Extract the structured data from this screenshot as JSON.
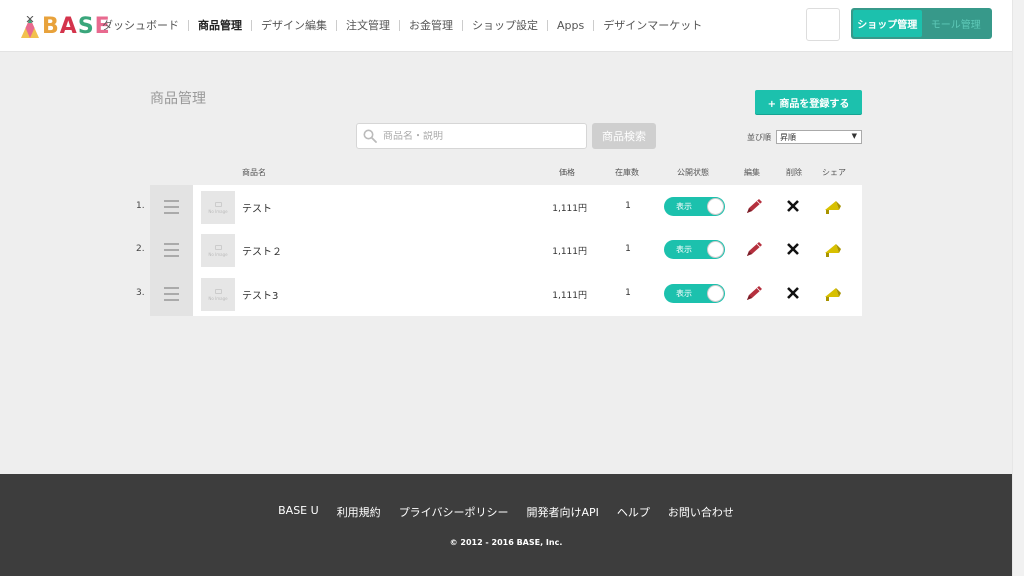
{
  "header": {
    "logo_text": [
      "B",
      "A",
      "S",
      "E"
    ],
    "nav": [
      {
        "label": "ダッシュボード"
      },
      {
        "label": "商品管理"
      },
      {
        "label": "デザイン編集"
      },
      {
        "label": "注文管理"
      },
      {
        "label": "お金管理"
      },
      {
        "label": "ショップ設定"
      },
      {
        "label": "Apps"
      },
      {
        "label": "デザインマーケット"
      }
    ],
    "active_nav": "商品管理",
    "mode_switch": {
      "shop": "ショップ管理",
      "mall": "モール管理"
    }
  },
  "main": {
    "title": "商品管理",
    "add_button": "+ 商品を登録する",
    "search_placeholder": "商品名・説明",
    "search_button": "商品検索",
    "sort_label": "並び順",
    "sort_value": "昇順",
    "columns": {
      "name": "商品名",
      "price": "価格",
      "stock": "在庫数",
      "status": "公開状態",
      "edit": "編集",
      "delete": "削除",
      "share": "シェア"
    },
    "products": [
      {
        "num": "1.",
        "name": "テスト",
        "price": "1,111円",
        "stock": "1",
        "status": "表示",
        "thumb": "No Image"
      },
      {
        "num": "2.",
        "name": "テスト２",
        "price": "1,111円",
        "stock": "1",
        "status": "表示",
        "thumb": "No Image"
      },
      {
        "num": "3.",
        "name": "テスト3",
        "price": "1,111円",
        "stock": "1",
        "status": "表示",
        "thumb": "No Image"
      }
    ]
  },
  "footer": {
    "links": [
      "BASE U",
      "利用規約",
      "プライバシーポリシー",
      "開発者向けAPI",
      "ヘルプ",
      "お問い合わせ"
    ],
    "copyright": "© 2012 - 2016 BASE, Inc."
  },
  "colors": {
    "accent": "#1cc1ad",
    "footer_bg": "#3d3d3d",
    "edit_icon": "#b5303e",
    "share_icon": "#d8c000"
  },
  "icons": {
    "search": "search-icon",
    "drag": "drag-handle-icon",
    "edit": "pencil-icon",
    "delete": "x-icon",
    "share": "megaphone-icon"
  }
}
